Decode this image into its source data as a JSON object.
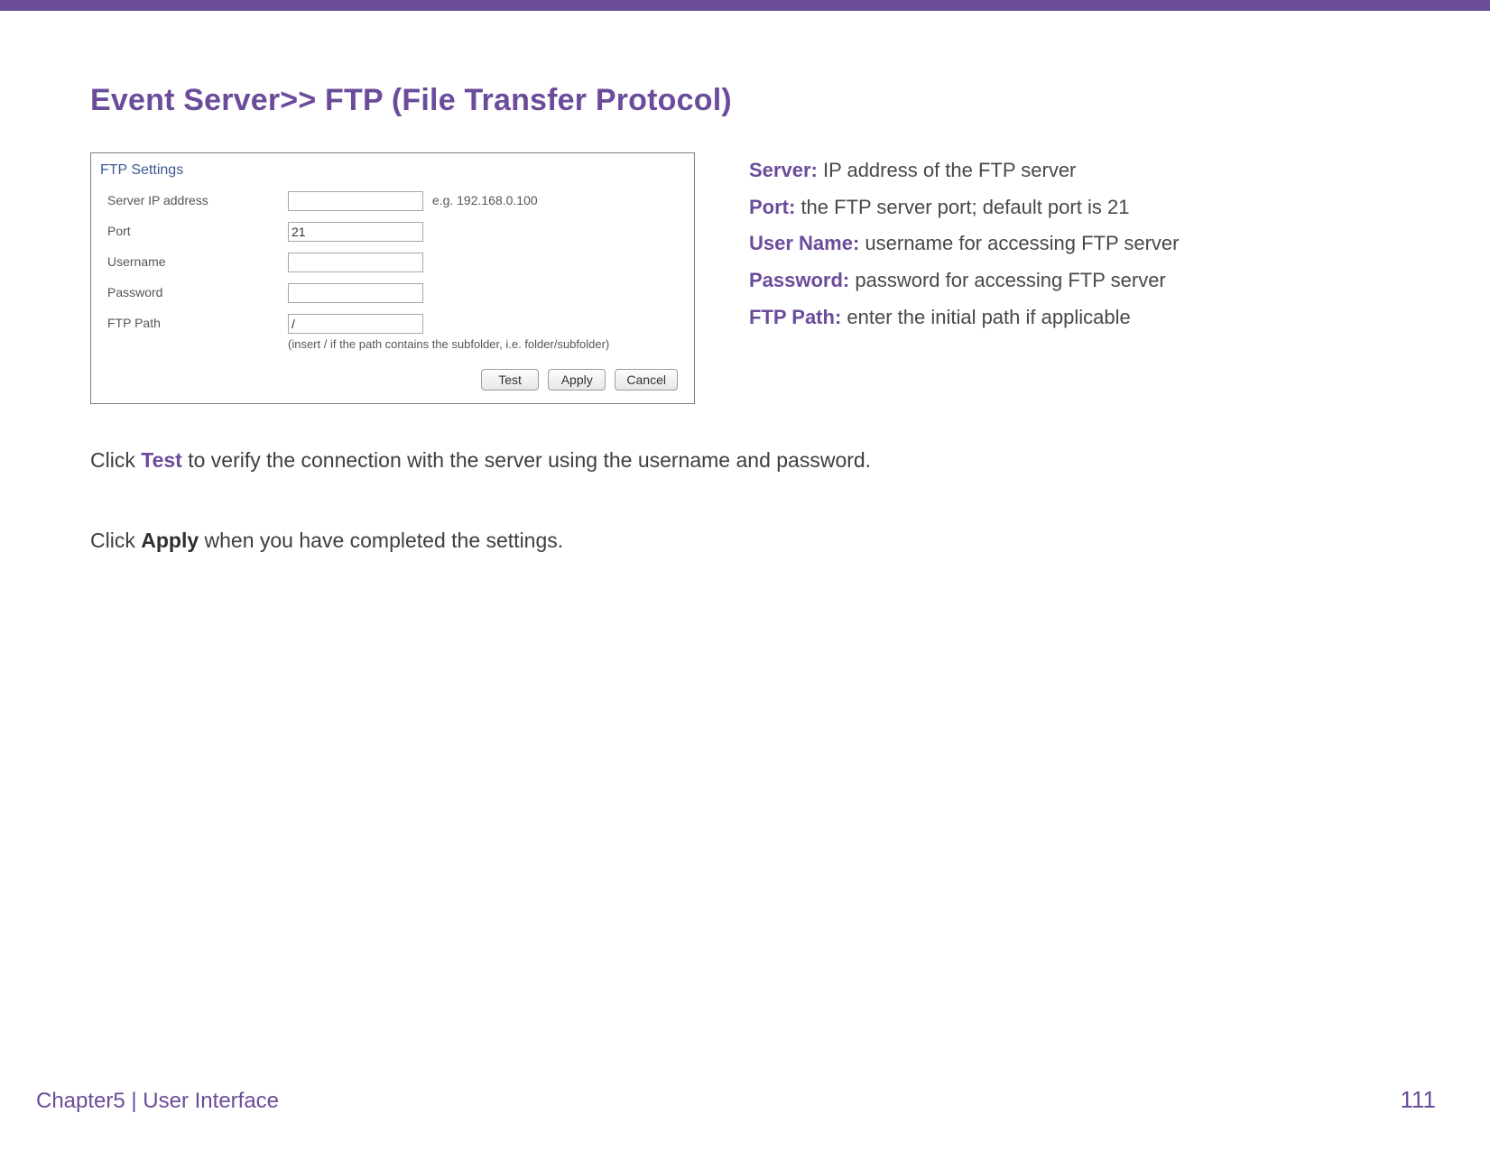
{
  "page": {
    "title": "Event Server>> FTP (File Transfer Protocol)"
  },
  "ftp": {
    "panel_title": "FTP Settings",
    "rows": {
      "server_ip_label": "Server IP address",
      "server_ip_value": "",
      "server_ip_hint": "e.g. 192.168.0.100",
      "port_label": "Port",
      "port_value": "21",
      "username_label": "Username",
      "username_value": "",
      "password_label": "Password",
      "password_value": "",
      "ftppath_label": "FTP Path",
      "ftppath_value": "/",
      "ftppath_hint": "(insert / if the path contains the subfolder, i.e. folder/subfolder)"
    },
    "buttons": {
      "test": "Test",
      "apply": "Apply",
      "cancel": "Cancel"
    }
  },
  "desc": {
    "server_label": "Server:",
    "server_text": " IP address of the FTP server",
    "port_label": "Port:",
    "port_text": " the FTP server port; default port is 21",
    "username_label": "User Name:",
    "username_text": " username for accessing FTP server",
    "password_label": "Password:",
    "password_text": " password for accessing FTP server",
    "ftppath_label": "FTP Path:",
    "ftppath_text": " enter the initial path if applicable"
  },
  "body": {
    "test_pre": "Click ",
    "test_word": "Test",
    "test_post": " to verify the connection with the server using the username and password.",
    "apply_pre": "Click ",
    "apply_word": "Apply",
    "apply_post": " when you have completed the settings."
  },
  "footer": {
    "left": "Chapter5  |  User Interface",
    "page_number": "111"
  }
}
